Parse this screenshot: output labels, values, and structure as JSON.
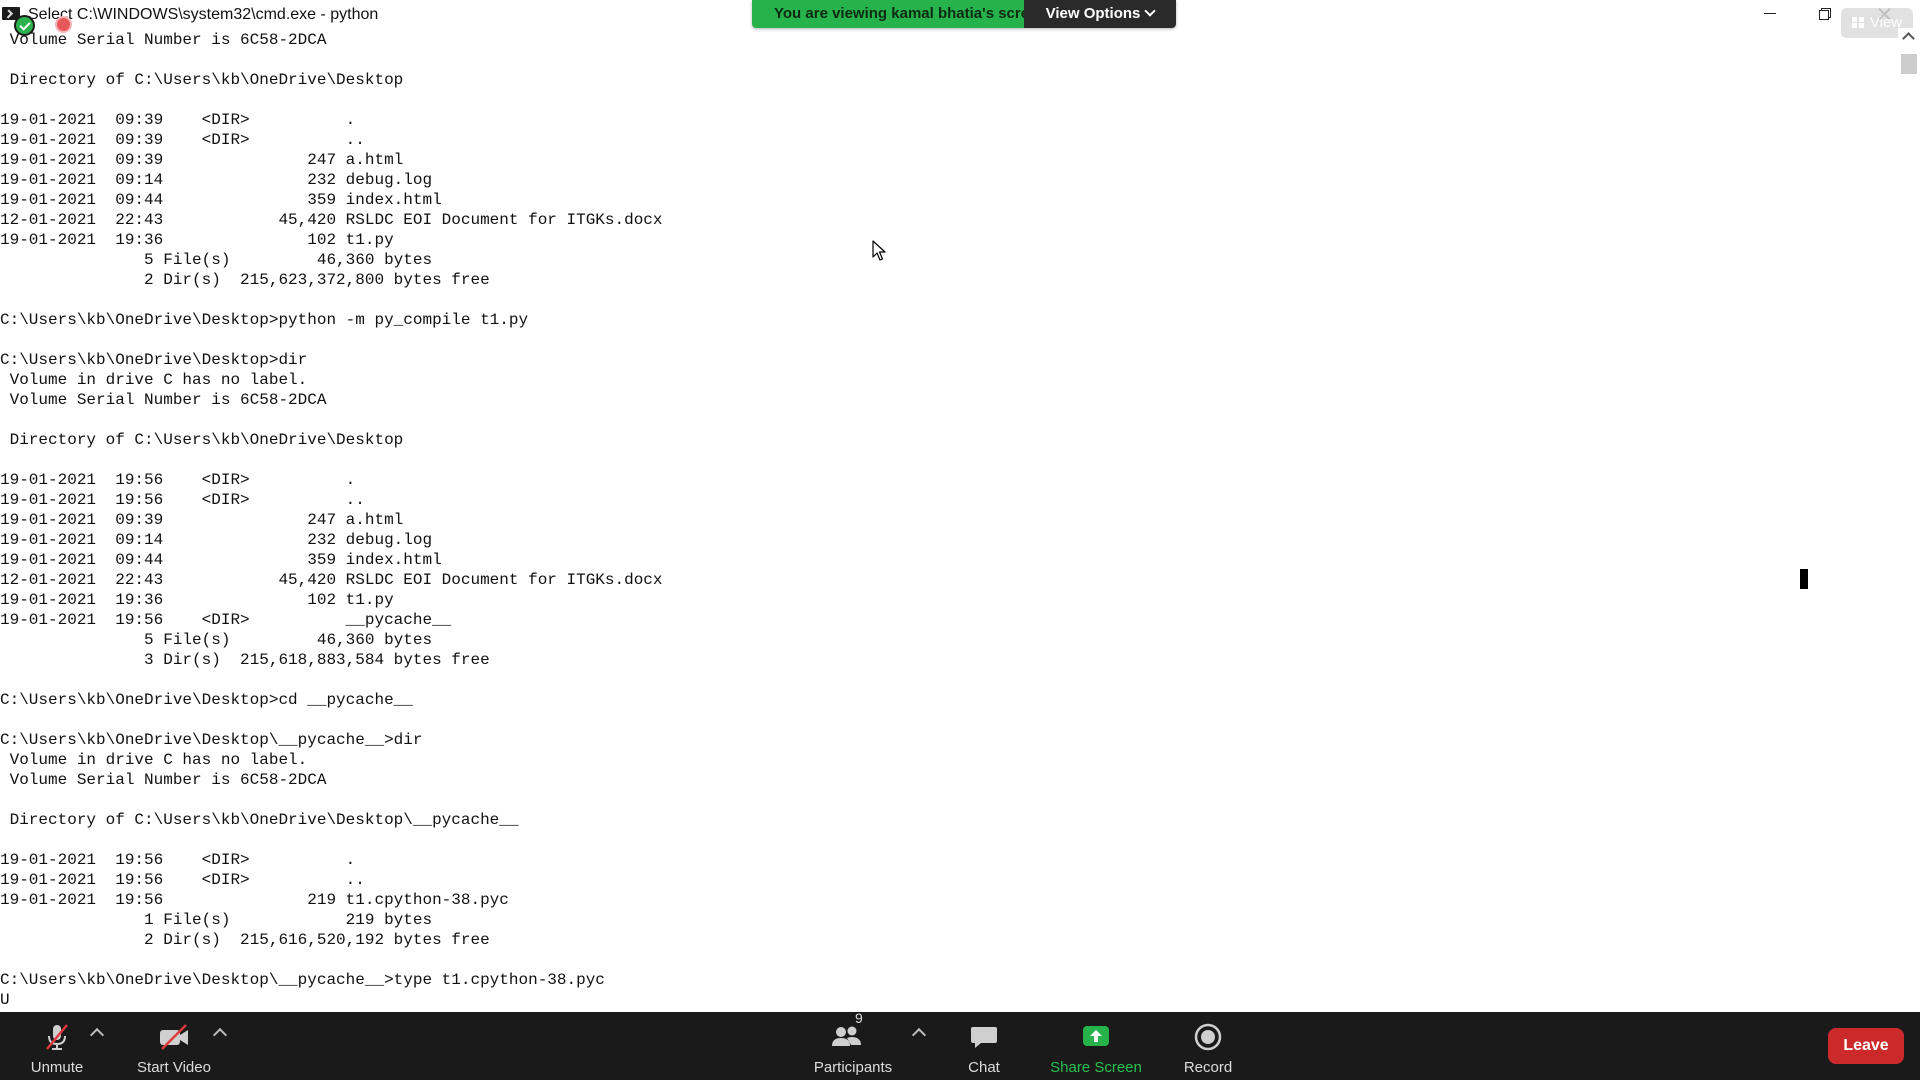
{
  "window": {
    "title": "Select C:\\WINDOWS\\system32\\cmd.exe - python"
  },
  "share_banner": {
    "viewing_text": "You are viewing kamal bhatia's screen",
    "view_options_label": "View Options"
  },
  "view_pill": {
    "label": "View"
  },
  "console": {
    "lines": [
      " Volume Serial Number is 6C58-2DCA",
      "",
      " Directory of C:\\Users\\kb\\OneDrive\\Desktop",
      "",
      "19-01-2021  09:39    <DIR>          .",
      "19-01-2021  09:39    <DIR>          ..",
      "19-01-2021  09:39               247 a.html",
      "19-01-2021  09:14               232 debug.log",
      "19-01-2021  09:44               359 index.html",
      "12-01-2021  22:43            45,420 RSLDC EOI Document for ITGKs.docx",
      "19-01-2021  19:36               102 t1.py",
      "               5 File(s)         46,360 bytes",
      "               2 Dir(s)  215,623,372,800 bytes free",
      "",
      "C:\\Users\\kb\\OneDrive\\Desktop>python -m py_compile t1.py",
      "",
      "C:\\Users\\kb\\OneDrive\\Desktop>dir",
      " Volume in drive C has no label.",
      " Volume Serial Number is 6C58-2DCA",
      "",
      " Directory of C:\\Users\\kb\\OneDrive\\Desktop",
      "",
      "19-01-2021  19:56    <DIR>          .",
      "19-01-2021  19:56    <DIR>          ..",
      "19-01-2021  09:39               247 a.html",
      "19-01-2021  09:14               232 debug.log",
      "19-01-2021  09:44               359 index.html",
      "12-01-2021  22:43            45,420 RSLDC EOI Document for ITGKs.docx",
      "19-01-2021  19:36               102 t1.py",
      "19-01-2021  19:56    <DIR>          __pycache__",
      "               5 File(s)         46,360 bytes",
      "               3 Dir(s)  215,618,883,584 bytes free",
      "",
      "C:\\Users\\kb\\OneDrive\\Desktop>cd __pycache__",
      "",
      "C:\\Users\\kb\\OneDrive\\Desktop\\__pycache__>dir",
      " Volume in drive C has no label.",
      " Volume Serial Number is 6C58-2DCA",
      "",
      " Directory of C:\\Users\\kb\\OneDrive\\Desktop\\__pycache__",
      "",
      "19-01-2021  19:56    <DIR>          .",
      "19-01-2021  19:56    <DIR>          ..",
      "19-01-2021  19:56               219 t1.cpython-38.pyc",
      "               1 File(s)            219 bytes",
      "               2 Dir(s)  215,616,520,192 bytes free",
      "",
      "C:\\Users\\kb\\OneDrive\\Desktop\\__pycache__>type t1.cpython-38.pyc",
      "U"
    ]
  },
  "toolbar": {
    "unmute_label": "Unmute",
    "start_video_label": "Start Video",
    "participants_label": "Participants",
    "participants_count": "9",
    "chat_label": "Chat",
    "share_screen_label": "Share Screen",
    "record_label": "Record",
    "leave_label": "Leave"
  },
  "colors": {
    "share_green": "#26b34c",
    "toolbar_bg": "#1a1a1a",
    "leave_red": "#cc2a2a",
    "muted_red": "#e0393e"
  }
}
